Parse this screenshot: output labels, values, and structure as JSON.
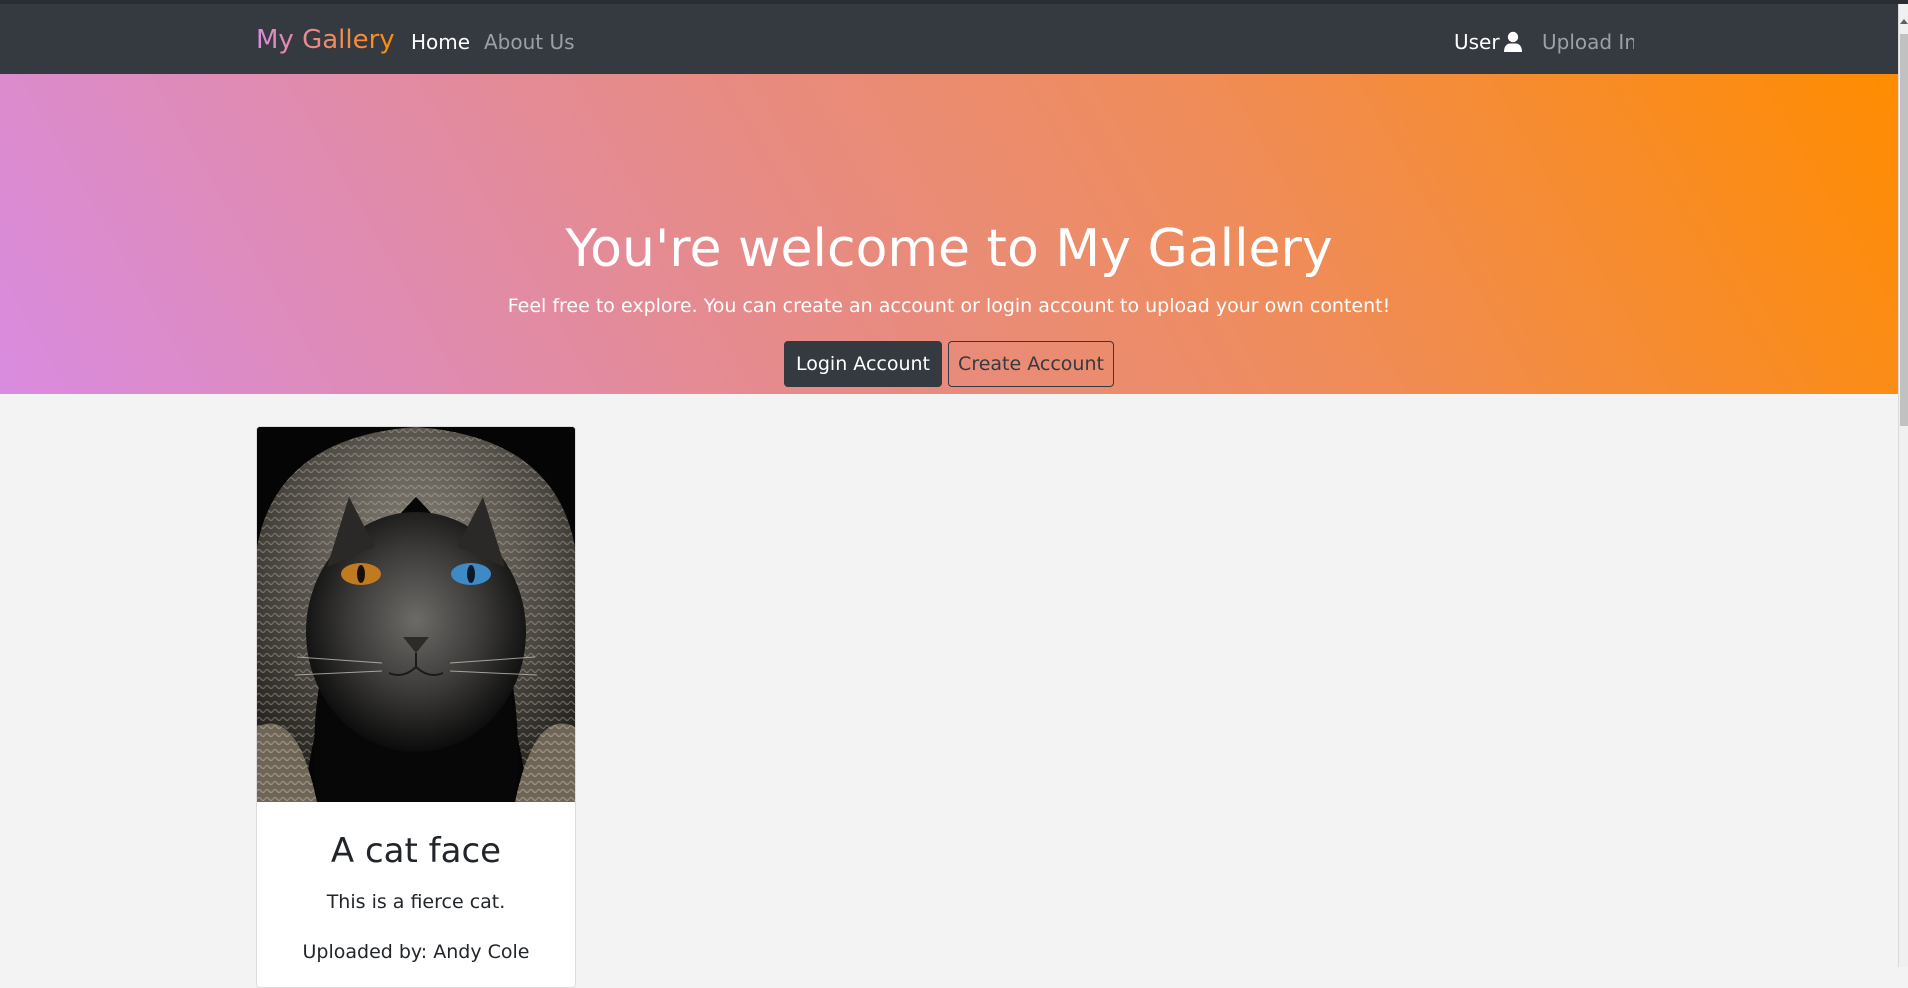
{
  "navbar": {
    "brand": "My Gallery",
    "links": {
      "home": "Home",
      "about": "About Us",
      "user": "User",
      "upload": "Upload Im"
    },
    "icons": {
      "user": "user-icon"
    }
  },
  "hero": {
    "title": "You're welcome to My Gallery",
    "subtitle": "Feel free to explore. You can create an account or login account to upload your own content!",
    "login_button": "Login Account",
    "create_button": "Create Account"
  },
  "cards": [
    {
      "title": "A cat face",
      "description": "This is a fierce cat.",
      "uploader": "Uploaded by: Andy Cole"
    }
  ],
  "colors": {
    "navbar_bg": "#343a40",
    "gradient_start": "#d98be0",
    "gradient_end": "#ff8c00",
    "page_bg": "#f3f3f3"
  }
}
